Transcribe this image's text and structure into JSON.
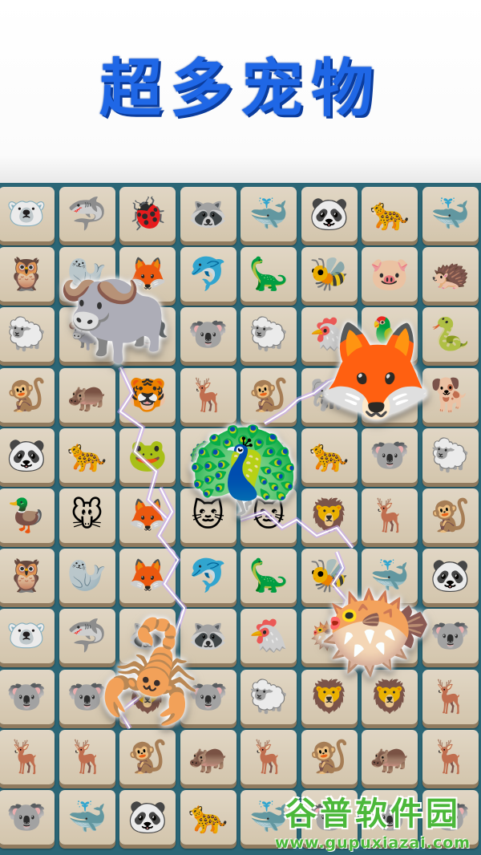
{
  "header": {
    "title": "超多宠物"
  },
  "board": {
    "columns": 8,
    "rows": [
      [
        "polar-bear",
        "shark",
        "ladybug",
        "raccoon",
        "whale",
        "panda",
        "leopard",
        "whale"
      ],
      [
        "owl",
        "seal",
        "fox",
        "dolphin",
        "triceratops",
        "bee",
        "pig",
        "hedgehog"
      ],
      [
        "sheep",
        "yak",
        "koala",
        "koala",
        "sheep",
        "rooster",
        "toucan",
        "snake"
      ],
      [
        "monkey",
        "hippo",
        "tiger",
        "deer",
        "monkey",
        "elephant",
        "fox",
        "dog"
      ],
      [
        "panda",
        "leopard",
        "frog",
        "peacock",
        "koala",
        "leopard",
        "koala",
        "sheep"
      ],
      [
        "duck",
        "mouse",
        "fox",
        "cat",
        "cat",
        "lion",
        "deer",
        "monkey"
      ],
      [
        "owl",
        "seal",
        "fox",
        "dolphin",
        "triceratops",
        "bee",
        "whale",
        "panda"
      ],
      [
        "polar-bear",
        "shark",
        "raccoon",
        "raccoon",
        "rooster",
        "pufferfish",
        "polar-bear",
        "koala"
      ],
      [
        "koala",
        "koala",
        "lion",
        "koala",
        "sheep",
        "lion",
        "lion",
        "deer"
      ],
      [
        "deer",
        "deer",
        "monkey",
        "hippo",
        "deer",
        "monkey",
        "hippo",
        "deer"
      ],
      [
        "koala",
        "whale",
        "panda",
        "leopard",
        "whale",
        "koala",
        "koala",
        "koala"
      ]
    ],
    "highlighted": [
      "yak",
      "fox",
      "peacock",
      "pufferfish",
      "scorpion"
    ]
  },
  "icons": {
    "polar-bear": "🐻‍❄️",
    "shark": "🦈",
    "ladybug": "🐞",
    "raccoon": "🦝",
    "whale": "🐳",
    "panda": "🐼",
    "leopard": "🐆",
    "owl": "🦉",
    "seal": "🦭",
    "fox": "🦊",
    "dolphin": "🐬",
    "triceratops": "🦕",
    "bee": "🐝",
    "pig": "🐷",
    "hedgehog": "🦔",
    "sheep": "🐑",
    "yak": "🐃",
    "koala": "🐨",
    "rooster": "🐔",
    "toucan": "🦜",
    "snake": "🐍",
    "monkey": "🐒",
    "hippo": "🦛",
    "tiger": "🐯",
    "deer": "🦌",
    "elephant": "🐘",
    "dog": "🐕",
    "frog": "🐸",
    "peacock": "🦚",
    "duck": "🦆",
    "mouse": "🐭",
    "cat": "🐱",
    "lion": "🦁",
    "pufferfish": "🐡",
    "scorpion": "🦂"
  },
  "watermark": {
    "name": "谷普软件园",
    "url": "www.gupuxiazai.com"
  }
}
